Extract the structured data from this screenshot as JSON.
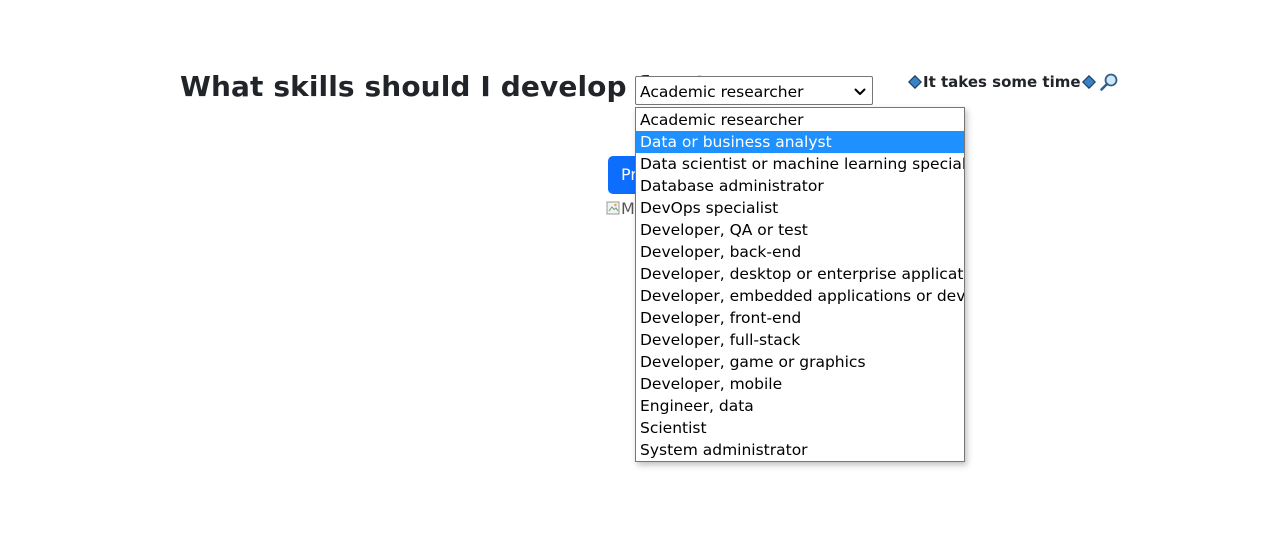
{
  "heading": "What skills should I develop for ?",
  "select": {
    "value": "Academic researcher",
    "options": [
      "Academic researcher",
      "Data or business analyst",
      "Data scientist or machine learning specialist",
      "Database administrator",
      "DevOps specialist",
      "Developer, QA or test",
      "Developer, back-end",
      "Developer, desktop or enterprise applications",
      "Developer, embedded applications or devices",
      "Developer, front-end",
      "Developer, full-stack",
      "Developer, game or graphics",
      "Developer, mobile",
      "Engineer, data",
      "Scientist",
      "System administrator"
    ],
    "highlighted": "Data or business analyst"
  },
  "note": {
    "text": "It takes some time",
    "icons": [
      "blue-diamond-icon",
      "blue-diamond-icon",
      "magnifier-icon"
    ]
  },
  "predict_button": {
    "label": "Pr"
  },
  "broken_image": {
    "alt": "M"
  },
  "colors": {
    "accent": "#0d6efd",
    "highlight": "#1e90ff",
    "diamond": "#3b82c4"
  }
}
